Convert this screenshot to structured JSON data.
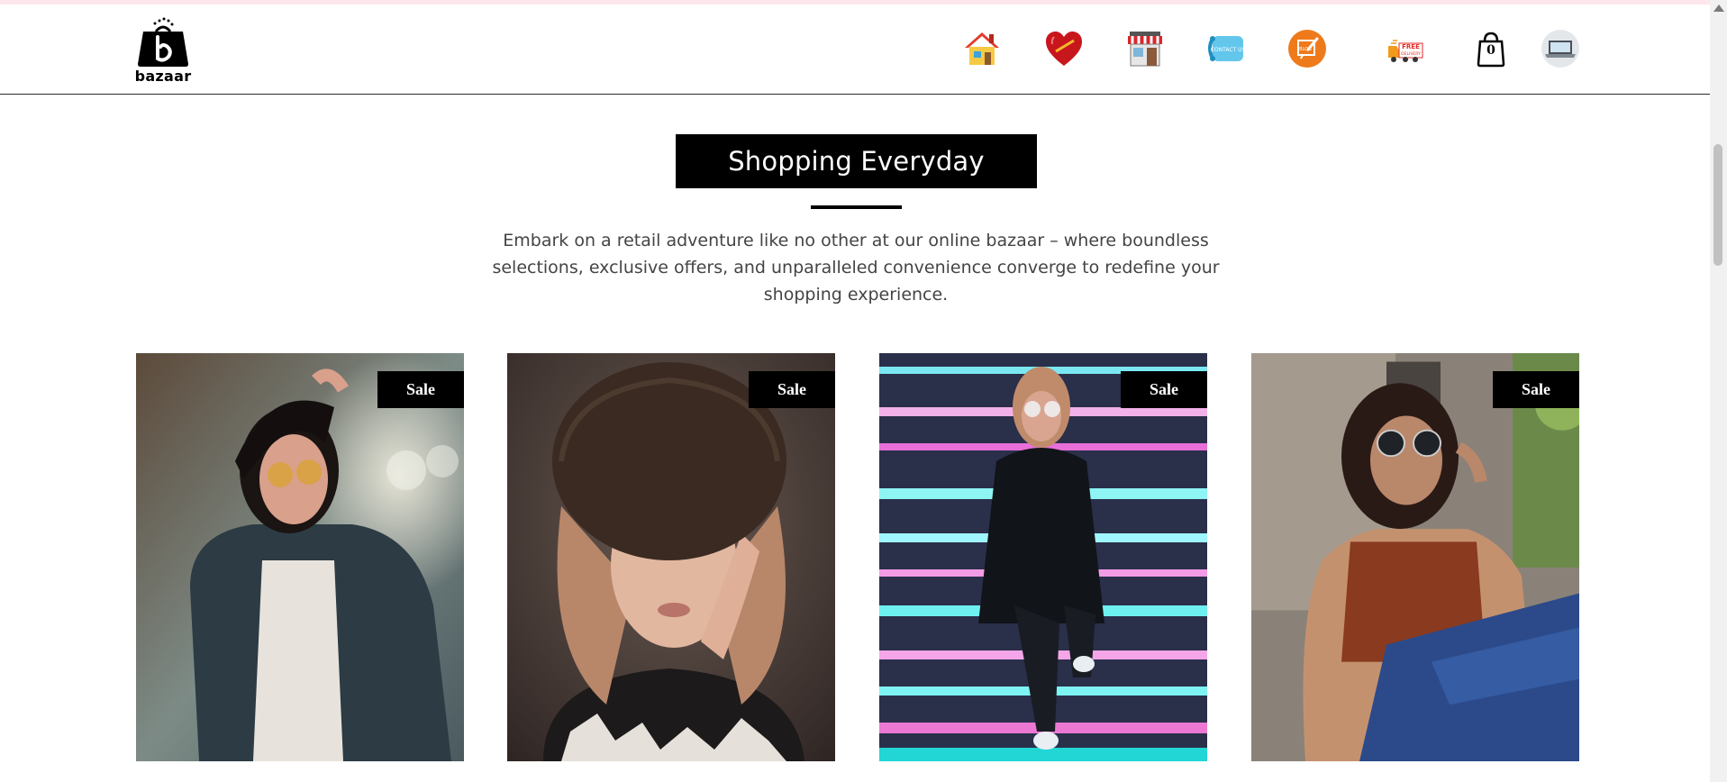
{
  "brand": {
    "name": "bazaar",
    "icon": "shopping-bag-logo"
  },
  "nav": [
    {
      "name": "home-icon",
      "label": ""
    },
    {
      "name": "heart-icon",
      "label": ""
    },
    {
      "name": "store-icon",
      "label": ""
    },
    {
      "name": "contact-us-icon",
      "label": "CONTACT US"
    },
    {
      "name": "blog-icon",
      "label": "BLOG"
    },
    {
      "name": "free-delivery-icon",
      "label": "FREE DELIVERY"
    },
    {
      "name": "cart-icon",
      "label": ""
    },
    {
      "name": "profile-icon",
      "label": ""
    }
  ],
  "cart": {
    "count": "0"
  },
  "section": {
    "title": "Shopping Everyday",
    "intro": "Embark on a retail adventure like no other at our online bazaar – where boundless selections, exclusive offers, and unparalleled convenience converge to redefine your shopping experience."
  },
  "products": [
    {
      "badge": "Sale",
      "image": "woman-denim-jacket-sunglasses"
    },
    {
      "badge": "Sale",
      "image": "woman-fur-hat-portrait"
    },
    {
      "badge": "Sale",
      "image": "woman-neon-stairs"
    },
    {
      "badge": "Sale",
      "image": "woman-orange-top-sunglasses"
    }
  ],
  "colors": {
    "accent": "#000000",
    "background": "#ffffff",
    "text": "#444444"
  }
}
